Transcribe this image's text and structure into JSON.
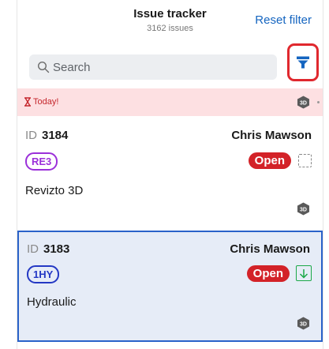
{
  "header": {
    "title": "Issue tracker",
    "subtitle": "3162 issues",
    "reset_label": "Reset filter"
  },
  "search": {
    "placeholder": "Search",
    "icon": "search-icon"
  },
  "filter": {
    "icon": "filter-icon",
    "highlight_color": "#e0282e"
  },
  "group": {
    "label": "Today!",
    "icon": "hourglass-icon",
    "chip": "3D"
  },
  "issues": [
    {
      "id_label": "ID",
      "id": "3184",
      "assignee": "Chris Mawson",
      "code": "RE3",
      "code_color": "#9b30d9",
      "status": "Open",
      "type": "Revizto 3D",
      "chip": "3D",
      "selected": false
    },
    {
      "id_label": "ID",
      "id": "3183",
      "assignee": "Chris Mawson",
      "code": "1HY",
      "code_color": "#2438c4",
      "status": "Open",
      "type": "Hydraulic",
      "chip": "3D",
      "selected": true
    }
  ],
  "colors": {
    "accent": "#1565c0",
    "status_open": "#d32228",
    "today_bg": "#fde0e2",
    "selected_bg": "#e6ecf7",
    "selected_border": "#2a62c9"
  }
}
